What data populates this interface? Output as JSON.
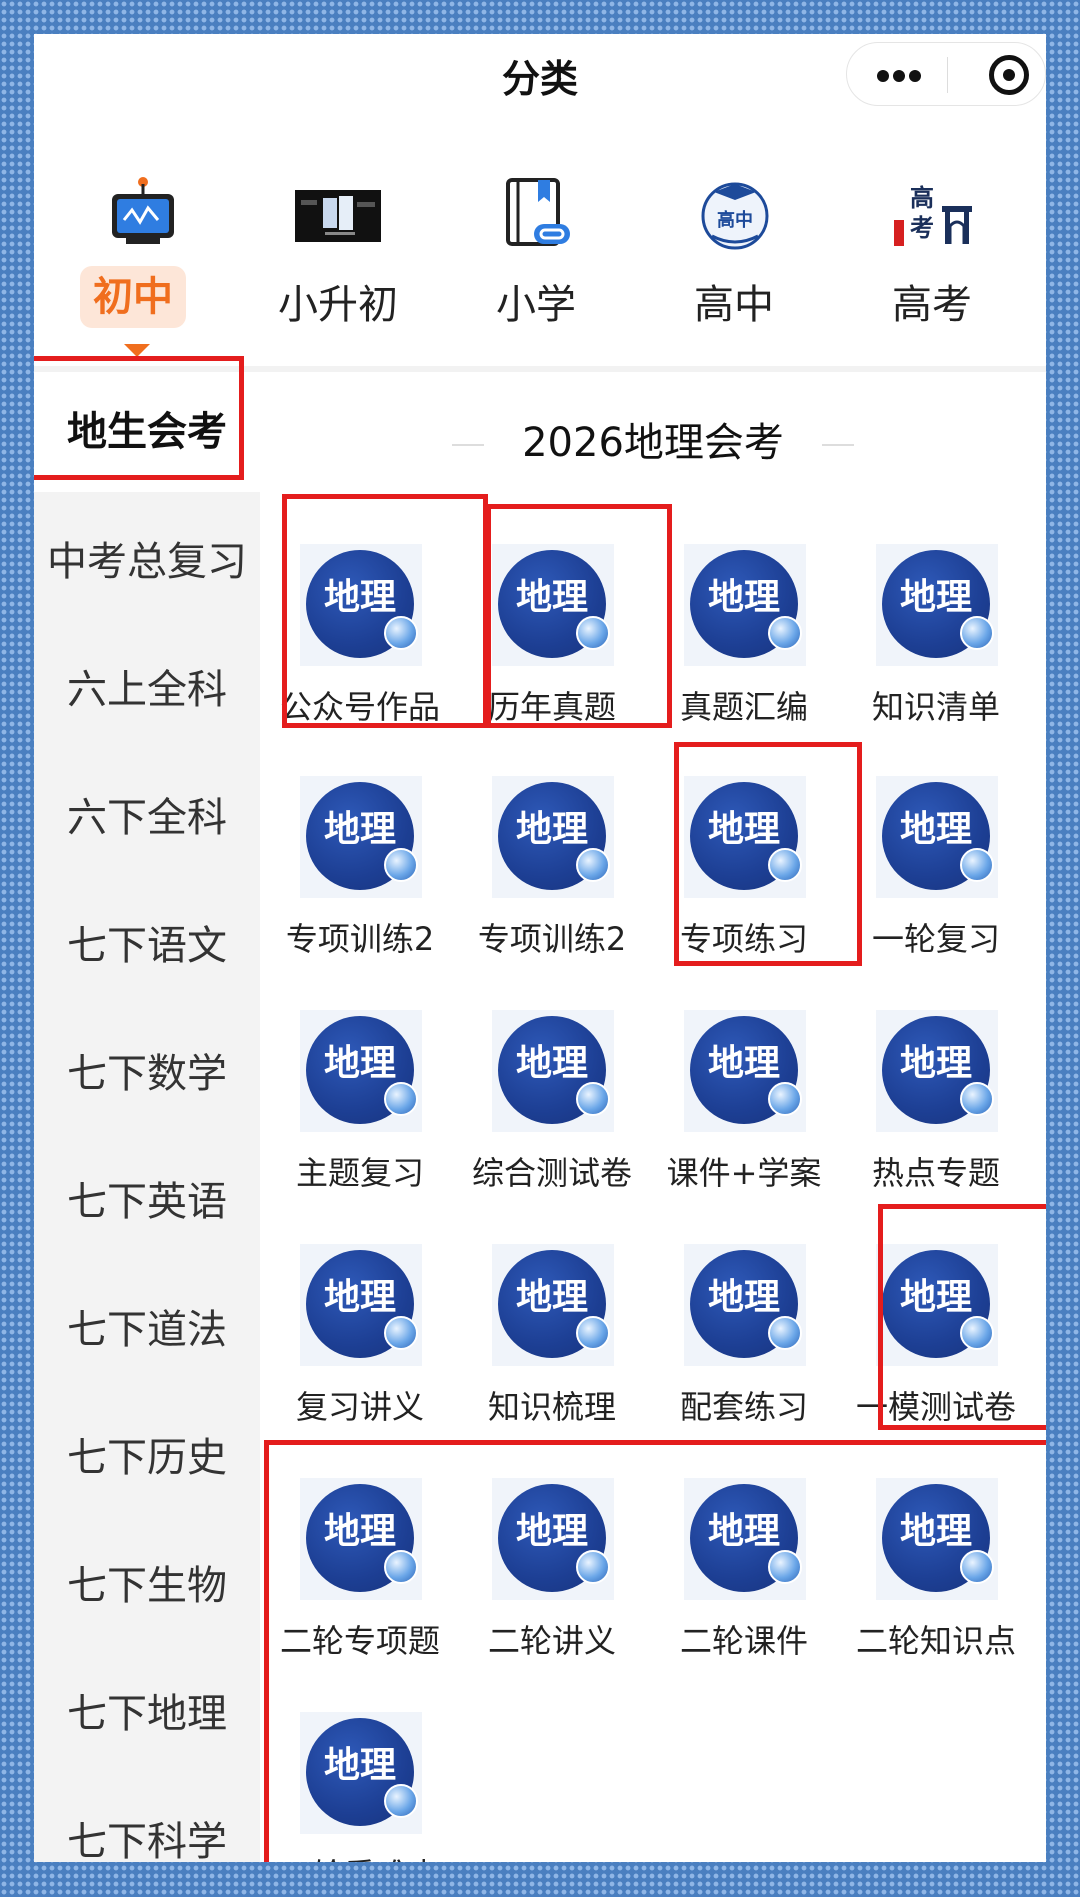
{
  "header": {
    "title": "分类"
  },
  "top_tabs": [
    {
      "label": "初中",
      "icon": "blackboard-icon",
      "active": true
    },
    {
      "label": "小升初",
      "icon": "banner-image-icon",
      "active": false
    },
    {
      "label": "小学",
      "icon": "book-link-icon",
      "active": false
    },
    {
      "label": "高中",
      "icon": "graduation-cap-badge-icon",
      "active": false
    },
    {
      "label": "高考",
      "icon": "gaokao-gate-icon",
      "active": false
    }
  ],
  "sidebar": {
    "items": [
      {
        "label": "地生会考",
        "active": true
      },
      {
        "label": "中考总复习"
      },
      {
        "label": "六上全科"
      },
      {
        "label": "六下全科"
      },
      {
        "label": "七下语文"
      },
      {
        "label": "七下数学"
      },
      {
        "label": "七下英语"
      },
      {
        "label": "七下道法"
      },
      {
        "label": "七下历史"
      },
      {
        "label": "七下生物"
      },
      {
        "label": "七下地理"
      },
      {
        "label": "七下科学"
      }
    ]
  },
  "content": {
    "section_title": "2026地理会考",
    "icon_text": "地理",
    "items": [
      {
        "label": "公众号作品"
      },
      {
        "label": "历年真题"
      },
      {
        "label": "真题汇编"
      },
      {
        "label": "知识清单"
      },
      {
        "label": "专项训练2"
      },
      {
        "label": "专项训练2"
      },
      {
        "label": "专项练习"
      },
      {
        "label": "一轮复习"
      },
      {
        "label": "主题复习"
      },
      {
        "label": "综合测试卷"
      },
      {
        "label": "课件+学案"
      },
      {
        "label": "热点专题"
      },
      {
        "label": "复习讲义"
      },
      {
        "label": "知识梳理"
      },
      {
        "label": "配套练习"
      },
      {
        "label": "一模测试卷"
      },
      {
        "label": "二轮专项题"
      },
      {
        "label": "二轮讲义"
      },
      {
        "label": "二轮课件"
      },
      {
        "label": "二轮知识点"
      },
      {
        "label": "二轮重难点"
      }
    ]
  },
  "colors": {
    "accent": "#f06e1e",
    "accent_bg": "#fde6d8",
    "annotation_red": "#e41d1d",
    "icon_blue": "#1d3f94"
  }
}
